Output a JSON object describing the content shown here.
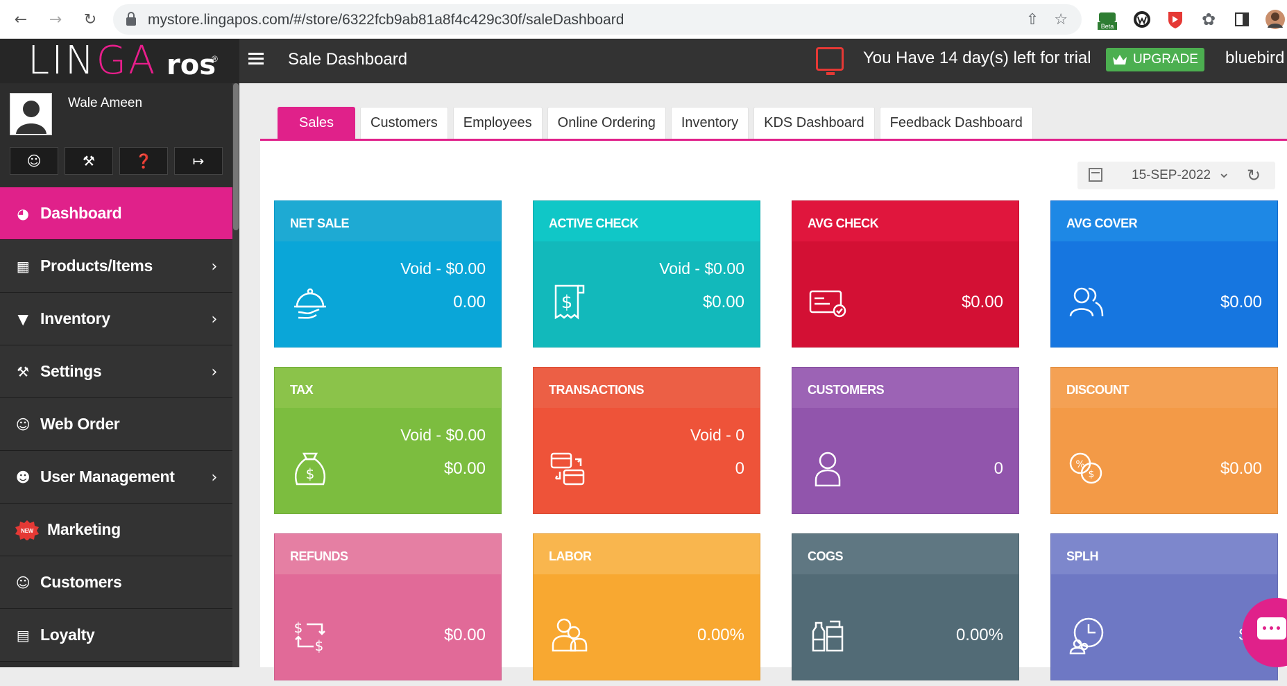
{
  "browser": {
    "url": "mystore.lingapos.com/#/store/6322fcb9ab81a8f4c429c30f/saleDashboard",
    "ext_beta_label": "Beta"
  },
  "header": {
    "logo_lin": "LIN",
    "logo_ga": "GA",
    "logo_pos": "ros",
    "logo_reg": "®",
    "title": "Sale Dashboard",
    "trial_text": "You Have 14 day(s) left for trial",
    "upgrade_label": "UPGRADE",
    "store_name": "bluebird"
  },
  "sidebar": {
    "user_name": "Wale Ameen",
    "items": [
      {
        "label": "Dashboard",
        "icon": "dashboard-icon",
        "active": true,
        "chevron": false
      },
      {
        "label": "Products/Items",
        "icon": "basket-icon",
        "active": false,
        "chevron": true
      },
      {
        "label": "Inventory",
        "icon": "inventory-basket-icon",
        "active": false,
        "chevron": true
      },
      {
        "label": "Settings",
        "icon": "wrench-icon",
        "active": false,
        "chevron": true
      },
      {
        "label": "Web Order",
        "icon": "web-order-icon",
        "active": false,
        "chevron": false
      },
      {
        "label": "User Management",
        "icon": "users-icon",
        "active": false,
        "chevron": true
      },
      {
        "label": "Marketing",
        "icon": "new-badge-icon",
        "active": false,
        "chevron": false,
        "badge": "NEW"
      },
      {
        "label": "Customers",
        "icon": "customer-icon",
        "active": false,
        "chevron": false
      },
      {
        "label": "Loyalty",
        "icon": "loyalty-icon",
        "active": false,
        "chevron": false
      }
    ]
  },
  "tabs": [
    {
      "label": "Sales",
      "active": true
    },
    {
      "label": "Customers",
      "active": false
    },
    {
      "label": "Employees",
      "active": false
    },
    {
      "label": "Online Ordering",
      "active": false
    },
    {
      "label": "Inventory",
      "active": false
    },
    {
      "label": "KDS Dashboard",
      "active": false
    },
    {
      "label": "Feedback Dashboard",
      "active": false
    }
  ],
  "date_filter": {
    "value": "15-SEP-2022"
  },
  "cards": [
    {
      "title": "NET SALE",
      "void": "Void - $0.00",
      "value": "0.00",
      "icon": "serving-tray-icon",
      "head_color": "#1eaad3",
      "body_color": "#0aa6d8"
    },
    {
      "title": "ACTIVE CHECK",
      "void": "Void - $0.00",
      "value": "$0.00",
      "icon": "receipt-dollar-icon",
      "head_color": "#10c7c7",
      "body_color": "#12b9bb"
    },
    {
      "title": "AVG CHECK",
      "void": "",
      "value": "$0.00",
      "icon": "credit-card-icon",
      "head_color": "#e0163d",
      "body_color": "#d31034"
    },
    {
      "title": "AVG COVER",
      "void": "",
      "value": "$0.00",
      "icon": "guests-icon",
      "head_color": "#1e88e5",
      "body_color": "#1676e0"
    },
    {
      "title": "TAX",
      "void": "Void - $0.00",
      "value": "$0.00",
      "icon": "money-bag-icon",
      "head_color": "#8bc34a",
      "body_color": "#7cbd3f"
    },
    {
      "title": "TRANSACTIONS",
      "void": "Void - 0",
      "value": "0",
      "icon": "transactions-icon",
      "head_color": "#ec5f45",
      "body_color": "#ee5339"
    },
    {
      "title": "CUSTOMERS",
      "void": "",
      "value": "0",
      "icon": "customer-person-icon",
      "head_color": "#9c63b5",
      "body_color": "#9155ac"
    },
    {
      "title": "DISCOUNT",
      "void": "",
      "value": "$0.00",
      "icon": "discount-coins-icon",
      "head_color": "#f4a154",
      "body_color": "#f39a47"
    },
    {
      "title": "REFUNDS",
      "void": "",
      "value": "$0.00",
      "icon": "refund-arrows-icon",
      "head_color": "#e57fa3",
      "body_color": "#e16a98"
    },
    {
      "title": "LABOR",
      "void": "",
      "value": "0.00%",
      "icon": "labor-people-icon",
      "head_color": "#f9b64e",
      "body_color": "#f8a831"
    },
    {
      "title": "COGS",
      "void": "",
      "value": "0.00%",
      "icon": "cogs-bottles-icon",
      "head_color": "#5f7782",
      "body_color": "#526b76"
    },
    {
      "title": "SPLH",
      "void": "",
      "value": "$0.",
      "icon": "clock-people-icon",
      "head_color": "#7d87cc",
      "body_color": "#6e78c4"
    }
  ]
}
